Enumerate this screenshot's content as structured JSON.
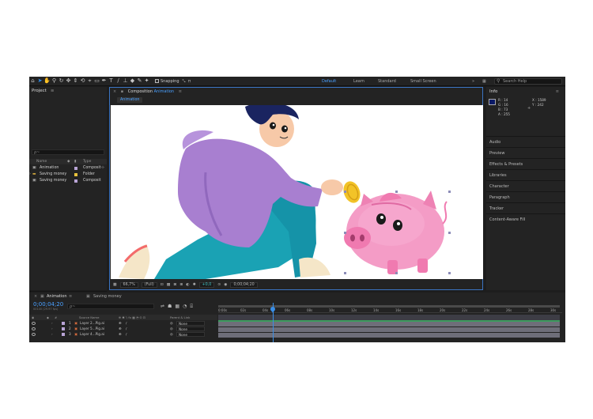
{
  "toolbar": {
    "tools": [
      "home-icon",
      "selection-icon",
      "hand-icon",
      "zoom-icon",
      "orbit-icon",
      "pan-icon",
      "dolly-icon",
      "rotate-icon",
      "camera-icon",
      "rectangle-icon",
      "pen-icon",
      "type-icon",
      "brush-icon",
      "clone-icon",
      "eraser-icon",
      "roto-icon",
      "puppet-icon"
    ],
    "snapping_label": "Snapping",
    "workspaces": [
      "Default",
      "Learn",
      "Standard",
      "Small Screen"
    ],
    "search_placeholder": "Search Help"
  },
  "project": {
    "title": "Project",
    "search": "ρ~",
    "col_name": "Name",
    "col_type": "Type",
    "items": [
      {
        "name": "Animation",
        "type": "Composit",
        "swatch": "#b9a4d6"
      },
      {
        "name": "Saving money",
        "type": "Folder",
        "swatch": "#e8c23c"
      },
      {
        "name": "Saving money",
        "type": "Composit",
        "swatch": "#b9a4d6"
      }
    ],
    "footer_bpc": "8 bpc"
  },
  "composition": {
    "title_prefix": "Composition",
    "title_name": "Animation",
    "tab": "Animation",
    "zoom": "66,7%",
    "resolution": "(Full)",
    "exposure": "+0,0",
    "timecode": "0;00;04;20"
  },
  "info": {
    "title": "Info",
    "r": "R : 14",
    "g": "G : 16",
    "b": "B : 73",
    "a": "A : 255",
    "x": "X : 1589",
    "y": "Y : 242",
    "panels": [
      "Audio",
      "Preview",
      "Effects & Presets",
      "Libraries",
      "Character",
      "Paragraph",
      "Tracker",
      "Content-Aware Fill"
    ],
    "swatch_color": "#0b1a66"
  },
  "timeline": {
    "tabs": [
      "Animation",
      "Saving money"
    ],
    "timecode": "0;00;04;20",
    "timecode_sub": "00140 (29.97 fps)",
    "search": "ρ~",
    "ruler_labels": [
      "0:00s",
      "02s",
      "04s",
      "06s",
      "08s",
      "10s",
      "12s",
      "14s",
      "16s",
      "18s",
      "20s",
      "22s",
      "24s",
      "26s",
      "28s",
      "30s"
    ],
    "col_num": "#",
    "col_source": "Source Name",
    "col_parent": "Parent & Link",
    "layers": [
      {
        "num": "1",
        "name": "Layer 2...Pig.ai",
        "parent": "None"
      },
      {
        "num": "2",
        "name": "Layer 5...Pig.ai",
        "parent": "None"
      },
      {
        "num": "3",
        "name": "Layer 4...Pig.ai",
        "parent": "None"
      }
    ]
  }
}
